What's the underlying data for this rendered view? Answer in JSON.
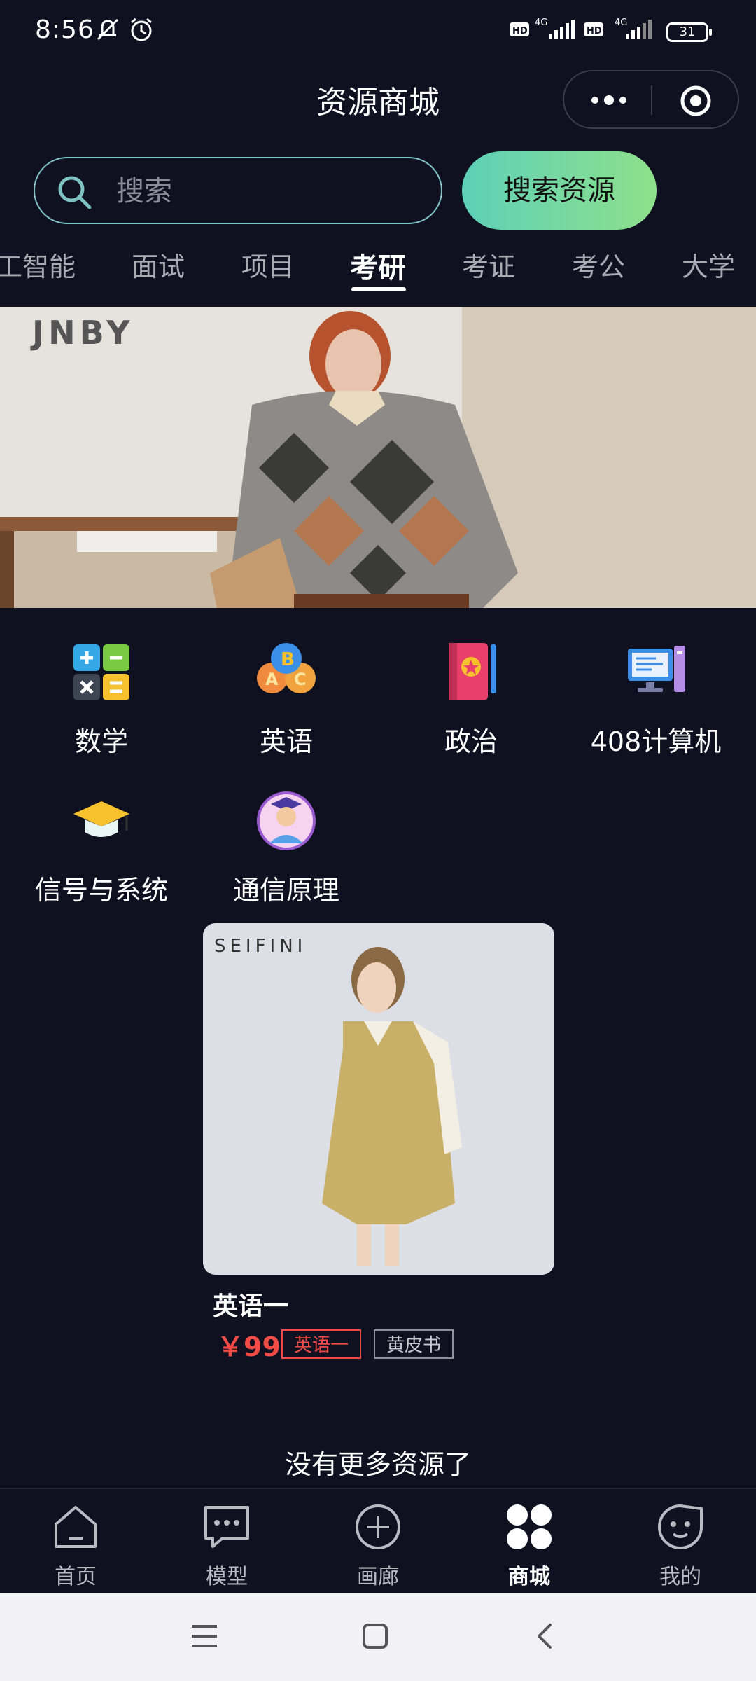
{
  "status_bar": {
    "time": "8:56",
    "battery": "31",
    "network_1": "4G",
    "network_2": "4G"
  },
  "header": {
    "title": "资源商城"
  },
  "search": {
    "placeholder": "搜索",
    "button_label": "搜索资源"
  },
  "tabs": [
    {
      "label": "工智能"
    },
    {
      "label": "面试"
    },
    {
      "label": "项目"
    },
    {
      "label": "考研",
      "active": true
    },
    {
      "label": "考证"
    },
    {
      "label": "考公"
    },
    {
      "label": "大学"
    }
  ],
  "banner": {
    "brand": "JNBY"
  },
  "categories": [
    {
      "label": "数学",
      "icon": "calculator-icon"
    },
    {
      "label": "英语",
      "icon": "abc-balloons-icon"
    },
    {
      "label": "政治",
      "icon": "red-book-icon"
    },
    {
      "label": "408计算机",
      "icon": "computer-icon"
    },
    {
      "label": "信号与系统",
      "icon": "graduation-cap-icon"
    },
    {
      "label": "通信原理",
      "icon": "graduate-avatar-icon"
    }
  ],
  "product": {
    "brand": "SEIFINI",
    "title": "英语一",
    "price": "￥99",
    "tags": [
      "英语一",
      "黄皮书"
    ]
  },
  "list_end_text": "没有更多资源了",
  "bottom_nav": [
    {
      "label": "首页",
      "icon": "home-icon"
    },
    {
      "label": "模型",
      "icon": "chat-bubble-icon"
    },
    {
      "label": "画廊",
      "icon": "plus-circle-icon"
    },
    {
      "label": "商城",
      "icon": "grid-clover-icon",
      "active": true
    },
    {
      "label": "我的",
      "icon": "smile-face-icon"
    }
  ],
  "colors": {
    "background": "#0f1020",
    "accent_gradient_start": "#5ed0b8",
    "accent_gradient_end": "#8ee08a",
    "price": "#f04b45"
  }
}
